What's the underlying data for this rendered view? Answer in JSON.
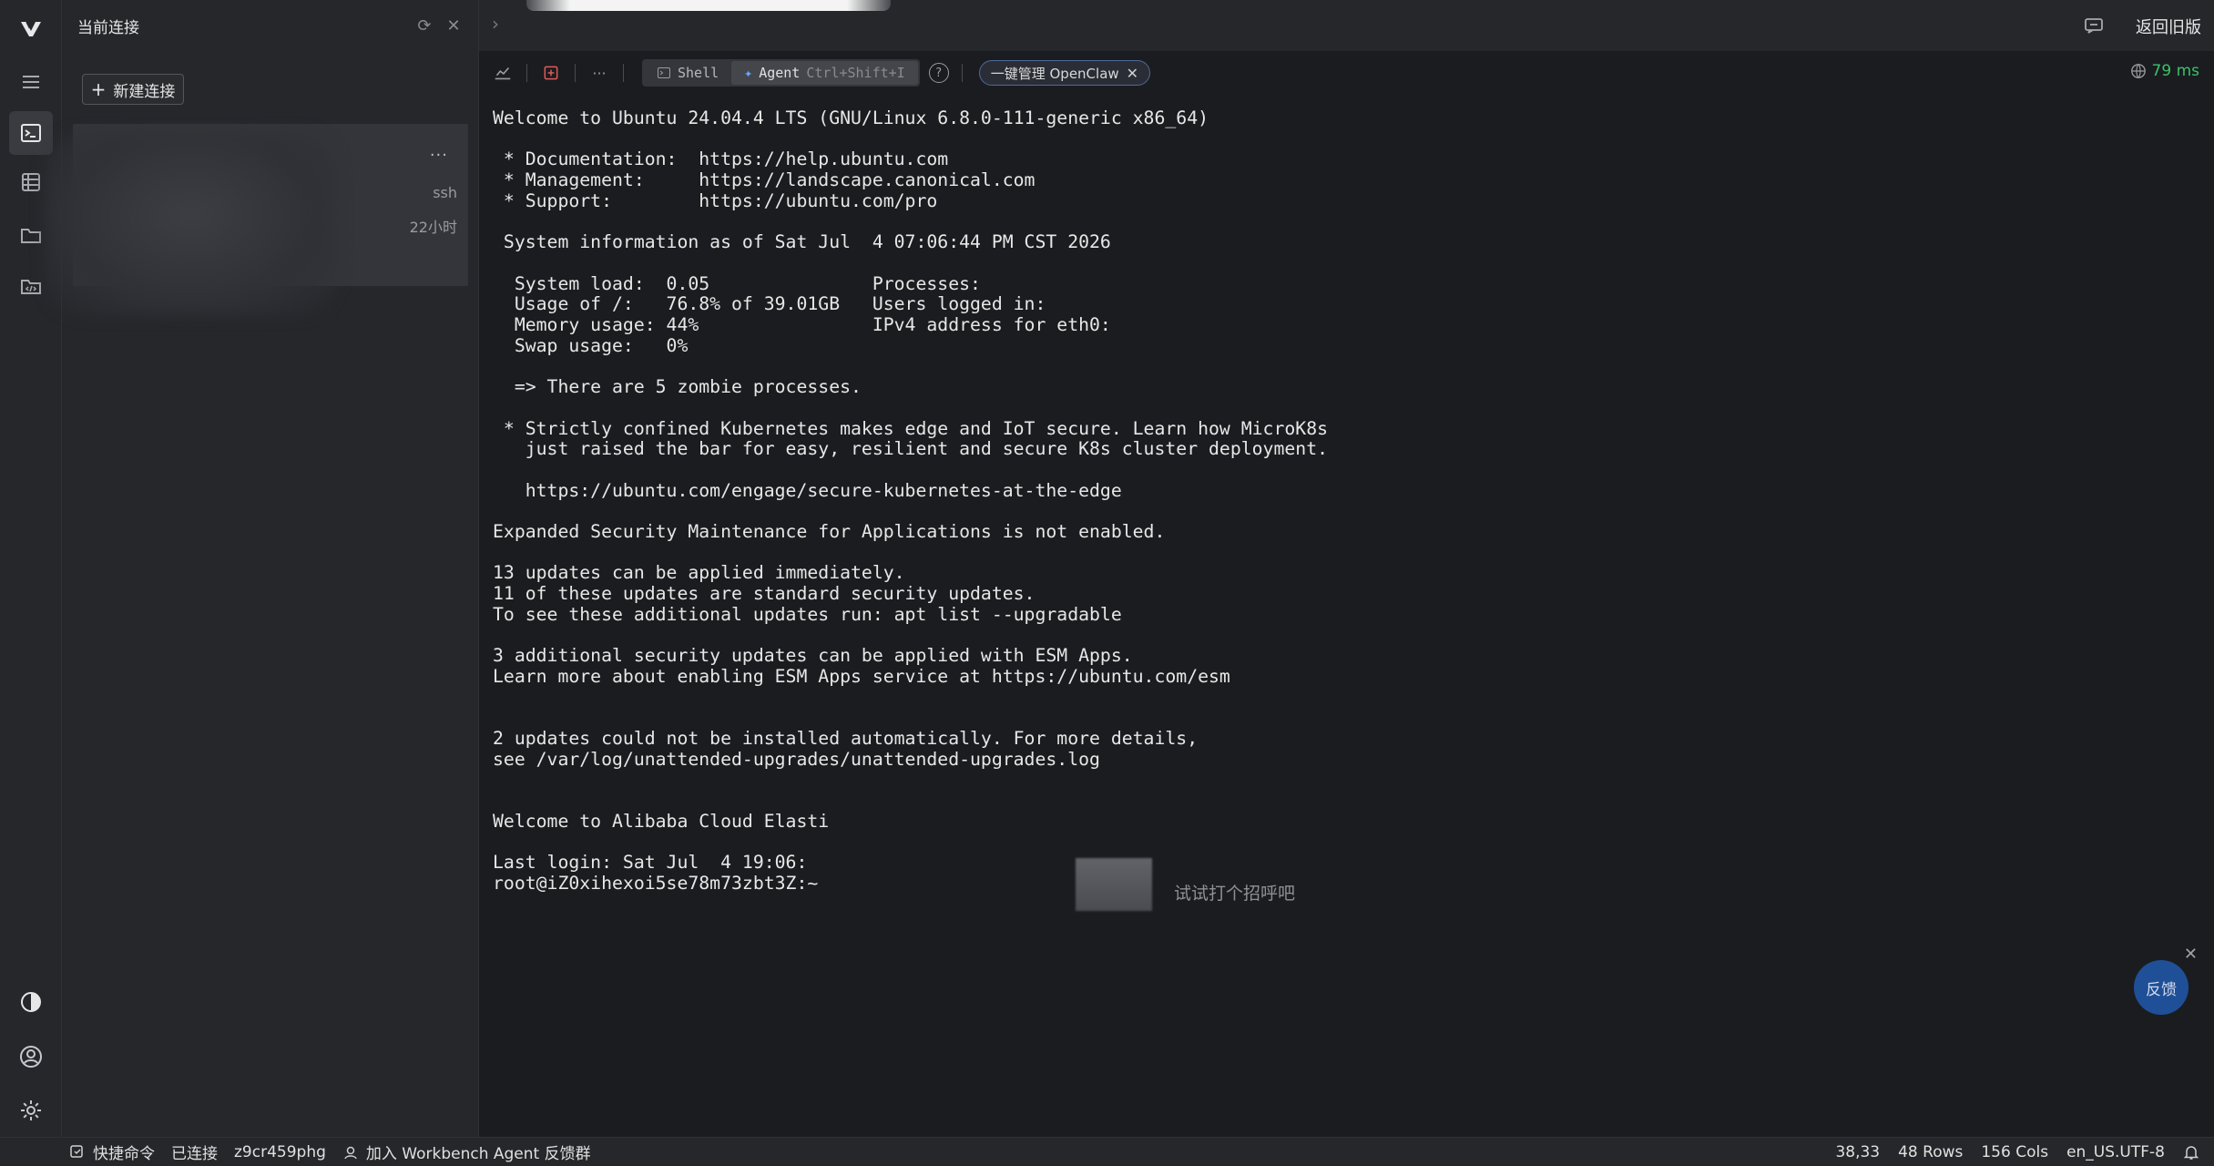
{
  "sidebar": {
    "title": "当前连接",
    "new_connection_label": "新建连接",
    "card": {
      "protocol": "ssh",
      "age": "22小时",
      "more": "···"
    }
  },
  "topbar": {
    "return_old_label": "返回旧版"
  },
  "toolbar": {
    "shell_label": "Shell",
    "agent_label": "Agent",
    "agent_shortcut": "Ctrl+Shift+I",
    "openclaw_label": "一键管理 OpenClaw",
    "latency": "79 ms",
    "latency_color": "#39c26a"
  },
  "terminal": {
    "lines": [
      "Welcome to Ubuntu 24.04.4 LTS (GNU/Linux 6.8.0-111-generic x86_64)",
      "",
      " * Documentation:  https://help.ubuntu.com",
      " * Management:     https://landscape.canonical.com",
      " * Support:        https://ubuntu.com/pro",
      "",
      " System information as of Sat Jul  4 07:06:44 PM CST 2026",
      "",
      "  System load:  0.05               Processes:",
      "  Usage of /:   76.8% of 39.01GB   Users logged in:",
      "  Memory usage: 44%                IPv4 address for eth0:",
      "  Swap usage:   0%",
      "",
      "  => There are 5 zombie processes.",
      "",
      " * Strictly confined Kubernetes makes edge and IoT secure. Learn how MicroK8s",
      "   just raised the bar for easy, resilient and secure K8s cluster deployment.",
      "",
      "   https://ubuntu.com/engage/secure-kubernetes-at-the-edge",
      "",
      "Expanded Security Maintenance for Applications is not enabled.",
      "",
      "13 updates can be applied immediately.",
      "11 of these updates are standard security updates.",
      "To see these additional updates run: apt list --upgradable",
      "",
      "3 additional security updates can be applied with ESM Apps.",
      "Learn more about enabling ESM Apps service at https://ubuntu.com/esm",
      "",
      "",
      "2 updates could not be installed automatically. For more details,",
      "see /var/log/unattended-upgrades/unattended-upgrades.log",
      "",
      "",
      "Welcome to Alibaba Cloud Elasti",
      "",
      "Last login: Sat Jul  4 19:06:",
      "root@iZ0xihexoi5se78m73zbt3Z:~"
    ],
    "greeting_hint": "试试打个招呼吧",
    "feedback_label": "反馈"
  },
  "statusbar": {
    "quick_commands": "快捷命令",
    "connected": "已连接",
    "session_id": "z9cr459phg",
    "join_feedback": "加入 Workbench Agent 反馈群",
    "cursor_pos": "38,33",
    "rows": "48 Rows",
    "cols": "156 Cols",
    "encoding": "en_US.UTF-8"
  }
}
